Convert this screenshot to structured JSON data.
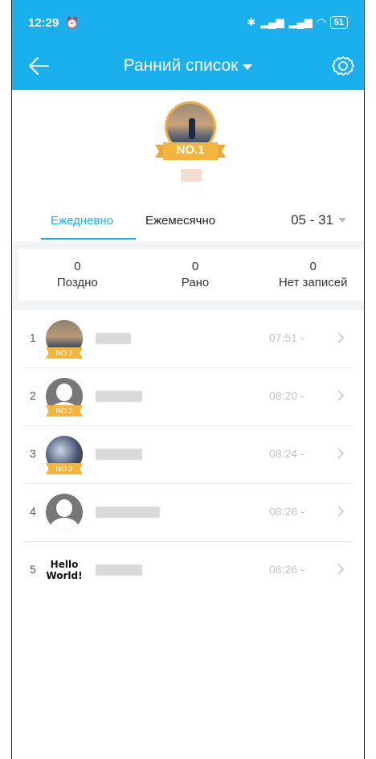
{
  "status": {
    "time": "12:29",
    "battery": "51"
  },
  "appbar": {
    "title": "Ранний список"
  },
  "champion": {
    "badge": "NO.1"
  },
  "tabs": {
    "daily": "Ежедневно",
    "monthly": "Ежемесячно",
    "date": "05 - 31"
  },
  "stats": [
    {
      "value": "0",
      "label": "Поздно"
    },
    {
      "value": "0",
      "label": "Рано"
    },
    {
      "value": "0",
      "label": "Нет записей"
    }
  ],
  "list": [
    {
      "rank": "1",
      "avatar": "photo",
      "medal": "NO.1",
      "time": "07:51 -"
    },
    {
      "rank": "2",
      "avatar": "default-user",
      "medal": "NO.2",
      "time": "08:20 -"
    },
    {
      "rank": "3",
      "avatar": "logo",
      "medal": "NO.3",
      "time": "08:24 -"
    },
    {
      "rank": "4",
      "avatar": "default-user",
      "medal": "",
      "time": "08:26 -"
    },
    {
      "rank": "5",
      "avatar": "hello-world",
      "avatar_text": "Hello World!",
      "medal": "",
      "time": "08:26 -"
    }
  ],
  "colors": {
    "accent": "#1ab0ee",
    "medal": "#f4b53f"
  }
}
